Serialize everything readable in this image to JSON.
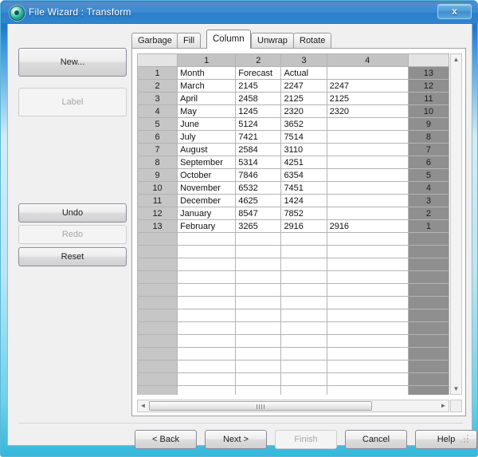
{
  "window": {
    "title": "File Wizard : Transform",
    "icon": "app-circle-icon",
    "close_label": "x"
  },
  "tabs": [
    {
      "label": "Garbage",
      "active": false
    },
    {
      "label": "Fill",
      "active": false
    },
    {
      "label": "Column",
      "active": true
    },
    {
      "label": "Unwrap",
      "active": false
    },
    {
      "label": "Rotate",
      "active": false
    }
  ],
  "side_buttons": [
    {
      "label": "New...",
      "enabled": true
    },
    {
      "label": "Label",
      "enabled": false
    },
    {
      "label": "Undo",
      "enabled": true
    },
    {
      "label": "Redo",
      "enabled": false
    },
    {
      "label": "Reset",
      "enabled": true
    }
  ],
  "grid": {
    "column_headers": [
      "1",
      "2",
      "3",
      "4"
    ],
    "rows": [
      {
        "num": "1",
        "cells": [
          "Month",
          "Forecast",
          "Actual",
          ""
        ],
        "tail": "13"
      },
      {
        "num": "2",
        "cells": [
          "March",
          "2145",
          "2247",
          "2247"
        ],
        "tail": "12"
      },
      {
        "num": "3",
        "cells": [
          "April",
          "2458",
          "2125",
          "2125"
        ],
        "tail": "11"
      },
      {
        "num": "4",
        "cells": [
          "May",
          "1245",
          "2320",
          "2320"
        ],
        "tail": "10"
      },
      {
        "num": "5",
        "cells": [
          "June",
          "5124",
          "3652",
          ""
        ],
        "tail": "9"
      },
      {
        "num": "6",
        "cells": [
          "July",
          "7421",
          "7514",
          ""
        ],
        "tail": "8"
      },
      {
        "num": "7",
        "cells": [
          "August",
          "2584",
          "3110",
          ""
        ],
        "tail": "7"
      },
      {
        "num": "8",
        "cells": [
          "September",
          "5314",
          "4251",
          ""
        ],
        "tail": "6"
      },
      {
        "num": "9",
        "cells": [
          "October",
          "7846",
          "6354",
          ""
        ],
        "tail": "5"
      },
      {
        "num": "10",
        "cells": [
          "November",
          "6532",
          "7451",
          ""
        ],
        "tail": "4"
      },
      {
        "num": "11",
        "cells": [
          "December",
          "4625",
          "1424",
          ""
        ],
        "tail": "3"
      },
      {
        "num": "12",
        "cells": [
          "January",
          "8547",
          "7852",
          ""
        ],
        "tail": "2"
      },
      {
        "num": "13",
        "cells": [
          "February",
          "3265",
          "2916",
          "2916"
        ],
        "tail": "1"
      },
      {
        "num": "",
        "cells": [
          "",
          "",
          "",
          ""
        ],
        "tail": ""
      },
      {
        "num": "",
        "cells": [
          "",
          "",
          "",
          ""
        ],
        "tail": ""
      },
      {
        "num": "",
        "cells": [
          "",
          "",
          "",
          ""
        ],
        "tail": ""
      },
      {
        "num": "",
        "cells": [
          "",
          "",
          "",
          ""
        ],
        "tail": ""
      },
      {
        "num": "",
        "cells": [
          "",
          "",
          "",
          ""
        ],
        "tail": ""
      },
      {
        "num": "",
        "cells": [
          "",
          "",
          "",
          ""
        ],
        "tail": ""
      },
      {
        "num": "",
        "cells": [
          "",
          "",
          "",
          ""
        ],
        "tail": ""
      },
      {
        "num": "",
        "cells": [
          "",
          "",
          "",
          ""
        ],
        "tail": ""
      },
      {
        "num": "",
        "cells": [
          "",
          "",
          "",
          ""
        ],
        "tail": ""
      },
      {
        "num": "",
        "cells": [
          "",
          "",
          "",
          ""
        ],
        "tail": ""
      },
      {
        "num": "",
        "cells": [
          "",
          "",
          "",
          ""
        ],
        "tail": ""
      },
      {
        "num": "",
        "cells": [
          "",
          "",
          "",
          ""
        ],
        "tail": ""
      },
      {
        "num": "",
        "cells": [
          "",
          "",
          "",
          ""
        ],
        "tail": ""
      }
    ]
  },
  "scrollbars": {
    "v_up": "▲",
    "v_down": "▼",
    "h_left": "◄",
    "h_right": "►"
  },
  "footer_buttons": [
    {
      "label": "< Back",
      "enabled": true
    },
    {
      "label": "Next >",
      "enabled": true
    },
    {
      "label": "Finish",
      "enabled": false
    },
    {
      "label": "Cancel",
      "enabled": true
    },
    {
      "label": "Help",
      "enabled": true
    }
  ]
}
